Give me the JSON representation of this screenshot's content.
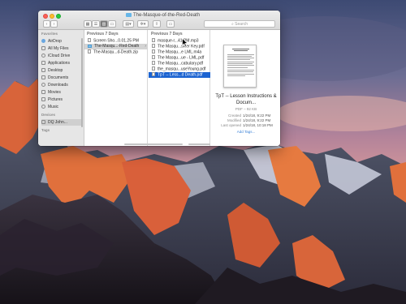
{
  "window": {
    "title": "The-Masque-of-the-Red-Death",
    "search_placeholder": "Search",
    "toolbar": {
      "back": "‹",
      "forward": "›",
      "view_icon": "▦",
      "view_list": "☰",
      "view_columns": "▥",
      "view_cover": "▭",
      "group": "▤▾",
      "action": "✲▾",
      "share": "⇧",
      "tags": "▭"
    }
  },
  "sidebar": {
    "favorites_header": "Favorites",
    "favorites": [
      {
        "label": "AirDrop",
        "icon": "airdrop-icon",
        "color": "#6aa7e0"
      },
      {
        "label": "All My Files",
        "icon": "all-files-icon",
        "color": "#8a8a8a"
      },
      {
        "label": "iCloud Drive",
        "icon": "cloud-icon",
        "color": "#8a8a8a"
      },
      {
        "label": "Applications",
        "icon": "applications-icon",
        "color": "#8a8a8a"
      },
      {
        "label": "Desktop",
        "icon": "desktop-icon",
        "color": "#8a8a8a"
      },
      {
        "label": "Documents",
        "icon": "documents-icon",
        "color": "#8a8a8a"
      },
      {
        "label": "Downloads",
        "icon": "downloads-icon",
        "color": "#8a8a8a"
      },
      {
        "label": "Movies",
        "icon": "movies-icon",
        "color": "#8a8a8a"
      },
      {
        "label": "Pictures",
        "icon": "pictures-icon",
        "color": "#8a8a8a"
      },
      {
        "label": "Music",
        "icon": "music-icon",
        "color": "#8a8a8a"
      }
    ],
    "devices_header": "Devices",
    "devices": [
      {
        "label": "DQ John...",
        "icon": "computer-icon",
        "color": "#8a8a8a"
      }
    ],
    "tags_header": "Tags"
  },
  "column1": {
    "header": "Previous 7 Days",
    "files": [
      {
        "name": "Screen Sho...0.01.25 PM",
        "kind": "file",
        "state": "normal"
      },
      {
        "name": "The-Masqu...-Red-Death",
        "kind": "folder",
        "state": "selected-grey"
      },
      {
        "name": "The-Masqu...d-Death.zip",
        "kind": "file",
        "state": "normal"
      }
    ]
  },
  "column2": {
    "header": "Previous 7 Days",
    "files": [
      {
        "name": "masque-r...41 PM.mp3",
        "kind": "file",
        "state": "normal"
      },
      {
        "name": "The Masqu...swer Key.pdf",
        "kind": "file",
        "state": "normal"
      },
      {
        "name": "The Masqu...e LML.m4a",
        "kind": "file",
        "state": "normal"
      },
      {
        "name": "The Masqu...ue - LML.pdf",
        "kind": "file",
        "state": "normal"
      },
      {
        "name": "The Masqu...cabulary.pdf",
        "kind": "file",
        "state": "normal"
      },
      {
        "name": "the_masqu...useYoung.pdf",
        "kind": "file",
        "state": "normal"
      },
      {
        "name": "TpT -- Less...d Death.pdf",
        "kind": "file",
        "state": "selected"
      }
    ]
  },
  "preview": {
    "title": "TpT -- Lesson Instructions & Docum...",
    "subtitle": "PDF – 92 KB",
    "meta": [
      {
        "key": "Created",
        "value": "1/24/18, 9:22 PM"
      },
      {
        "key": "Modified",
        "value": "1/24/18, 9:22 PM"
      },
      {
        "key": "Last opened",
        "value": "1/24/18, 10:18 PM"
      }
    ],
    "add_tags": "Add Tags..."
  },
  "colors": {
    "selection": "#1b63d1",
    "folder": "#7cc0ec",
    "link": "#3b82d8"
  }
}
